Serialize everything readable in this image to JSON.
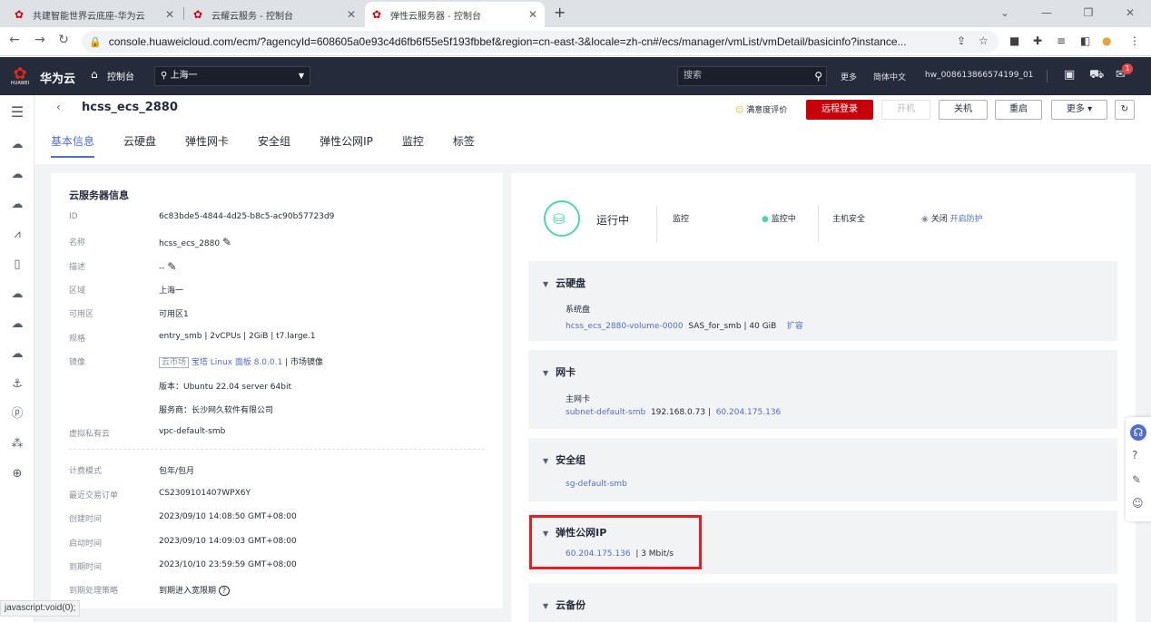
{
  "browser": {
    "tabs": [
      {
        "title": "共建智能世界云底座-华为云"
      },
      {
        "title": "云耀云服务 - 控制台"
      },
      {
        "title": "弹性云服务器 - 控制台"
      }
    ],
    "new_tab": "+",
    "url": "console.huaweicloud.com/ecm/?agencyId=608605a0e93c4d6fb6f55e5f193fbbef&region=cn-east-3&locale=zh-cn#/ecs/manager/vmList/vmDetail/basicinfo?instance...",
    "status_url": "javascript:void(0);"
  },
  "header": {
    "brand": "华为云",
    "logo_text": "HUAWEI",
    "console": "控制台",
    "region": "上海一",
    "search_placeholder": "搜索",
    "more": "更多",
    "lang": "简体中文",
    "user": "hw_008613866574199_01",
    "notif_count": "1"
  },
  "page": {
    "title": "hcss_ecs_2880",
    "satisfaction": "满意度评价",
    "buttons": {
      "remote": "远程登录",
      "start": "开机",
      "stop": "关机",
      "restart": "重启",
      "more": "更多"
    },
    "tabs": [
      "基本信息",
      "云硬盘",
      "弹性网卡",
      "安全组",
      "弹性公网IP",
      "监控",
      "标签"
    ]
  },
  "info": {
    "title": "云服务器信息",
    "id_k": "ID",
    "id_v": "6c83bde5-4844-4d25-b8c5-ac90b57723d9",
    "name_k": "名称",
    "name_v": "hcss_ecs_2880",
    "desc_k": "描述",
    "desc_v": "--",
    "region_k": "区域",
    "region_v": "上海一",
    "az_k": "可用区",
    "az_v": "可用区1",
    "spec_k": "规格",
    "spec_v": "entry_smb | 2vCPUs | 2GiB | t7.large.1",
    "image_k": "镜像",
    "image_tag": "云市场",
    "image_link": "宝塔 Linux 面板 8.0.0.1",
    "image_suffix": " | 市场镜像",
    "version": "版本：Ubuntu 22.04 server 64bit",
    "vendor": "服务商：长沙网久软件有限公司",
    "vpc_k": "虚拟私有云",
    "vpc_v": "vpc-default-smb",
    "billing_k": "计费模式",
    "billing_v": "包年/包月",
    "order_k": "最近交易订单",
    "order_v": "CS2309101407WPX6Y",
    "created_k": "创建时间",
    "created_v": "2023/09/10 14:08:50 GMT+08:00",
    "launched_k": "启动时间",
    "launched_v": "2023/09/10 14:09:03 GMT+08:00",
    "expire_k": "到期时间",
    "expire_v": "2023/10/10 23:59:59 GMT+08:00",
    "policy_k": "到期处理策略",
    "policy_v": "到期进入宽限期"
  },
  "status": {
    "running": "运行中",
    "monitor_k": "监控",
    "monitor_v": "监控中",
    "hostsec_k": "主机安全",
    "hostsec_v": "关闭",
    "hostsec_link": "开启防护"
  },
  "sections": {
    "disk": {
      "title": "云硬盘",
      "sub": "系统盘",
      "link": "hcss_ecs_2880-volume-0000",
      "detail": "SAS_for_smb  |  40 GiB",
      "action": "扩容"
    },
    "nic": {
      "title": "网卡",
      "sub": "主网卡",
      "link": "subnet-default-smb",
      "ip": "192.168.0.73  |",
      "eip": "60.204.175.136"
    },
    "sg": {
      "title": "安全组",
      "link": "sg-default-smb"
    },
    "eip": {
      "title": "弹性公网IP",
      "link": "60.204.175.136",
      "detail": "|  3 Mbit/s"
    },
    "backup": {
      "title": "云备份"
    }
  },
  "colors": {
    "accent": "#526ecc",
    "brand": "#c7000b",
    "highlight": "#e31e24",
    "running": "#50d4ab"
  }
}
